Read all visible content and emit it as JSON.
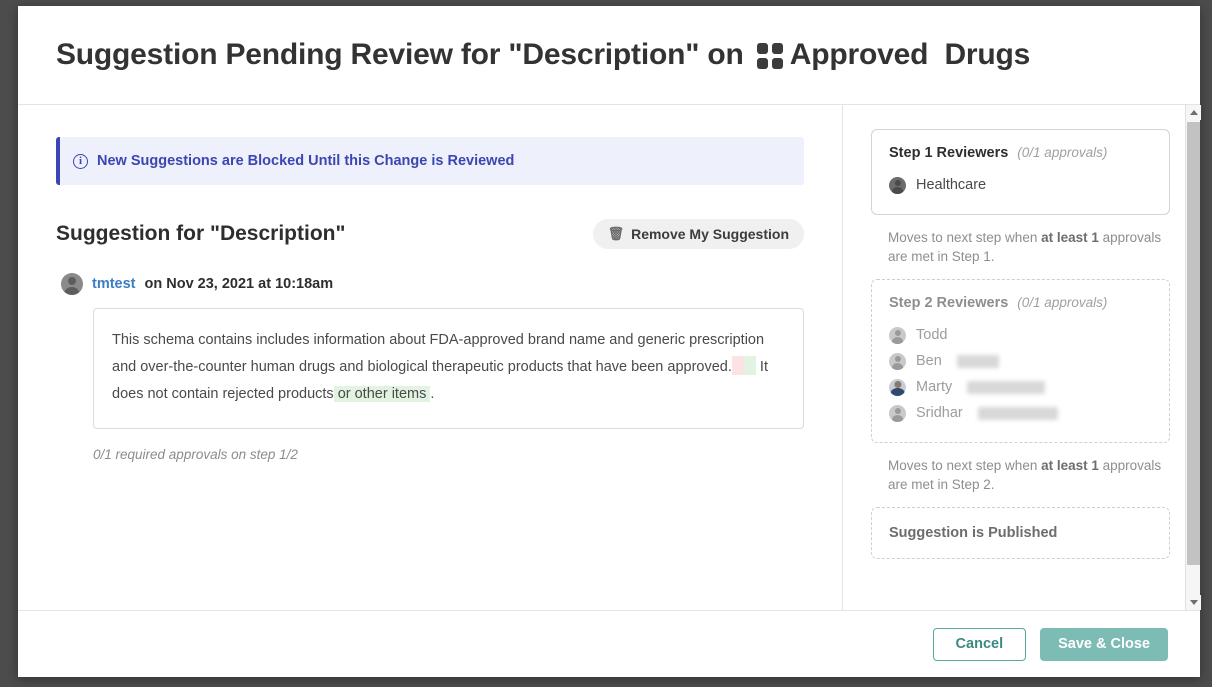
{
  "colors": {
    "backdrop": "#4c4c4c",
    "banner_accent": "#3b46b2",
    "banner_bg": "#eef0fb",
    "link": "#3b7ec4",
    "primary_button": "#7dbcb4",
    "secondary_button_border": "#5aa9a0",
    "diff_insert": "#e2f3e2",
    "diff_delete": "#fbe3e3"
  },
  "dialog": {
    "title_prefix": "Suggestion Pending Review for \"Description\" on ",
    "title_dataset": "Approved  Drugs",
    "dataset_icon": "grid-icon"
  },
  "banner": {
    "icon": "info-circle-icon",
    "text": "New Suggestions are Blocked Until this Change is Reviewed"
  },
  "suggestion": {
    "heading": "Suggestion for \"Description\"",
    "remove_button_label": "Remove My Suggestion",
    "remove_button_icon": "trash-icon",
    "author": "tmtest",
    "author_avatar": "user-avatar",
    "meta": "on Nov 23, 2021 at 10:18am",
    "body_part_1": "This schema contains includes information about FDA-approved brand name and generic prescription and over-the-counter human drugs and biological therapeutic products that have been approved.",
    "body_part_2": "It does not contain rejected products",
    "body_inserted": " or other items ",
    "body_part_3": ".",
    "approval_status": "0/1 required approvals on step 1/2"
  },
  "workflow": {
    "step1": {
      "title": "Step 1 Reviewers",
      "approvals": "(0/1 approvals)",
      "reviewers": [
        {
          "name": "Healthcare",
          "avatar": "group-avatar",
          "redacted_width": 0
        }
      ]
    },
    "note1_prefix": "Moves to next step when ",
    "note1_bold": "at least 1",
    "note1_suffix": " approvals are met in Step 1.",
    "step2": {
      "title": "Step 2 Reviewers",
      "approvals": "(0/1 approvals)",
      "reviewers": [
        {
          "name": "Todd",
          "avatar": "user-avatar",
          "redacted_width": 0
        },
        {
          "name": "Ben",
          "avatar": "user-avatar",
          "redacted_width": 42
        },
        {
          "name": "Marty",
          "avatar": "photo-avatar",
          "redacted_width": 78
        },
        {
          "name": "Sridhar",
          "avatar": "user-avatar",
          "redacted_width": 80
        }
      ]
    },
    "note2_prefix": "Moves to next step when ",
    "note2_bold": "at least 1",
    "note2_suffix": " approvals are met in Step 2.",
    "published_label": "Suggestion is Published"
  },
  "footer": {
    "cancel_label": "Cancel",
    "save_label": "Save & Close"
  },
  "scrollbar": {
    "up_icon": "chevron-up-icon",
    "down_icon": "chevron-down-icon"
  }
}
